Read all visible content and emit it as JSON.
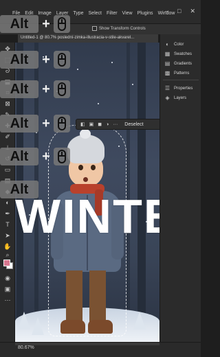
{
  "app": {
    "menu": [
      "File",
      "Edit",
      "Image",
      "Layer",
      "Type",
      "Select",
      "Filter",
      "View",
      "Plugins",
      "Window"
    ],
    "win_controls": [
      "–",
      "□",
      "✕"
    ]
  },
  "options_bar": {
    "show_transform_controls": "Show Transform Controls"
  },
  "document": {
    "tab_title": "Untitled-1 @ 80.7% poslední-zimka-illustracia-v-stile-akvarel..."
  },
  "canvas": {
    "big_text": "WINTE"
  },
  "task_bar": {
    "more_icon": "···",
    "deselect_label": "Deselect"
  },
  "panels": {
    "items": [
      {
        "label": "Color",
        "icon": "color-icon"
      },
      {
        "label": "Swatches",
        "icon": "swatches-icon"
      },
      {
        "label": "Gradients",
        "icon": "gradients-icon"
      },
      {
        "label": "Patterns",
        "icon": "patterns-icon"
      },
      {
        "label": "Properties",
        "icon": "properties-icon"
      },
      {
        "label": "Layers",
        "icon": "layers-icon"
      }
    ]
  },
  "status": {
    "zoom": "80.67%"
  },
  "overlay": {
    "alt_label": "Alt",
    "plus": "+",
    "rows": 6
  },
  "colors": {
    "foreground": "#d9778f",
    "background": "#ffffff"
  }
}
